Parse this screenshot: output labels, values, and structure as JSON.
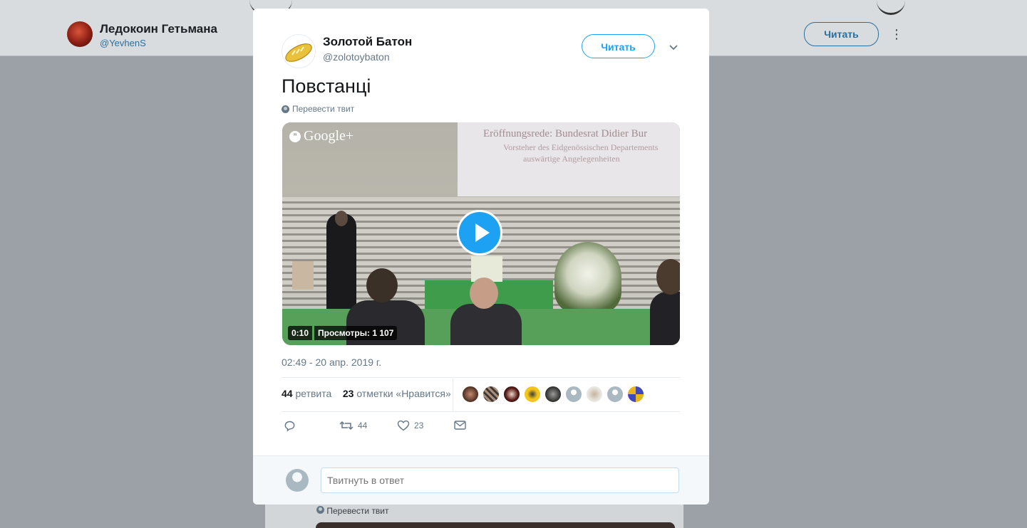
{
  "background": {
    "profile_name": "Ледокоин Гетьмана",
    "profile_handle": "@YevhenS",
    "follow_label": "Читать",
    "more_icon": "more-vertical-icon",
    "next_translate_label": "Перевести твит"
  },
  "tweet": {
    "author_name": "Золотой Батон",
    "author_handle": "@zolotoybaton",
    "follow_label": "Читать",
    "text": "Повстанці",
    "translate_label": "Перевести твит",
    "video": {
      "watermark": "Google+",
      "screen_title": "Eröffnungsrede: Bundesrat Didier Bur",
      "screen_line2": "Vorsteher des Eidgenössischen Departements",
      "screen_line3": "auswärtige Angelegenheiten",
      "duration": "0:10",
      "views": "Просмотры: 1 107"
    },
    "timestamp": "02:49 - 20 апр. 2019 г.",
    "stats": {
      "retweet_count": "44",
      "retweet_label": "ретвита",
      "like_count": "23",
      "like_label": "отметки «Нравится»"
    },
    "actions": {
      "reply_icon": "reply-icon",
      "retweet_icon": "retweet-icon",
      "retweet_count": "44",
      "like_icon": "heart-icon",
      "like_count": "23",
      "dm_icon": "envelope-icon"
    },
    "reply_placeholder": "Твитнуть в ответ"
  },
  "colors": {
    "accent": "#1da1f2",
    "secondary_text": "#657786",
    "overlay": "#9ba1a6"
  }
}
